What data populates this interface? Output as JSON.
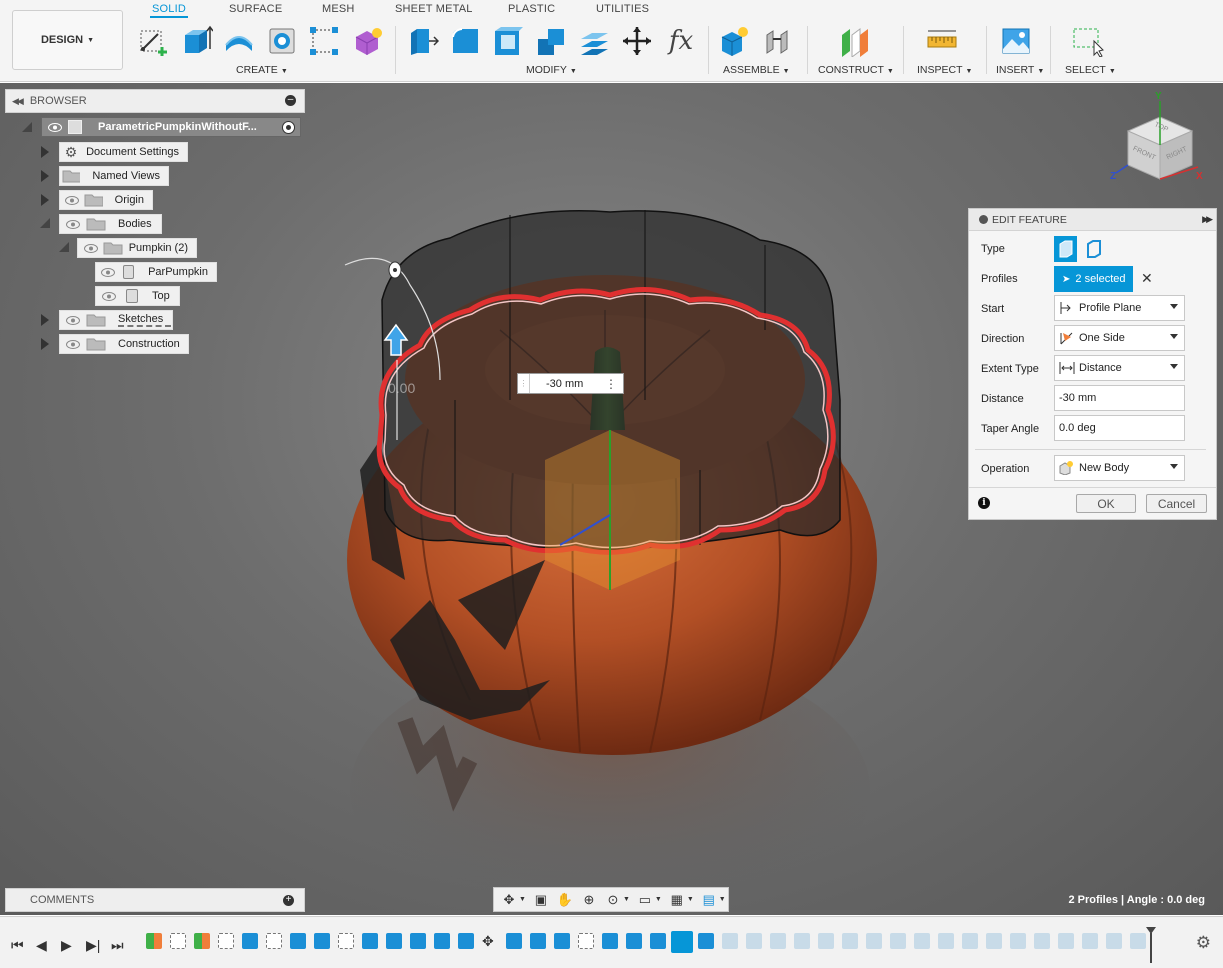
{
  "toolbar": {
    "design": "DESIGN",
    "tabs": [
      "SOLID",
      "SURFACE",
      "MESH",
      "SHEET METAL",
      "PLASTIC",
      "UTILITIES"
    ],
    "active_tab": "SOLID",
    "groups": {
      "create": "CREATE",
      "modify": "MODIFY",
      "assemble": "ASSEMBLE",
      "construct": "CONSTRUCT",
      "inspect": "INSPECT",
      "insert": "INSERT",
      "select": "SELECT"
    },
    "fx": "fx"
  },
  "browser": {
    "title": "BROWSER",
    "root": "ParametricPumpkinWithoutF...",
    "items": {
      "document_settings": "Document Settings",
      "named_views": "Named Views",
      "origin": "Origin",
      "bodies": "Bodies",
      "pumpkin": "Pumpkin (2)",
      "parpumpkin": "ParPumpkin",
      "top": "Top",
      "sketches": "Sketches",
      "construction": "Construction"
    }
  },
  "edit_feature": {
    "title": "EDIT FEATURE",
    "labels": {
      "type": "Type",
      "profiles": "Profiles",
      "start": "Start",
      "direction": "Direction",
      "extent_type": "Extent Type",
      "distance": "Distance",
      "taper_angle": "Taper Angle",
      "operation": "Operation"
    },
    "values": {
      "profiles": "2 selected",
      "start": "Profile Plane",
      "direction": "One Side",
      "extent_type": "Distance",
      "distance": "-30 mm",
      "taper_angle": "0.0 deg",
      "operation": "New Body"
    },
    "ok": "OK",
    "cancel": "Cancel"
  },
  "viewport": {
    "dimension_input": "-30 mm",
    "ghost_dimension": "0.00",
    "view_cube": {
      "top": "TOP",
      "front": "FRONT",
      "right": "RIGHT"
    },
    "axes": {
      "x": "X",
      "y": "Y",
      "z": "Z"
    }
  },
  "comments": {
    "title": "COMMENTS"
  },
  "status": "2 Profiles | Angle : 0.0 deg",
  "colors": {
    "accent": "#0696d7",
    "pumpkin": "#b8552a",
    "stem": "#3f6b2e",
    "profile_line": "#e03030"
  }
}
